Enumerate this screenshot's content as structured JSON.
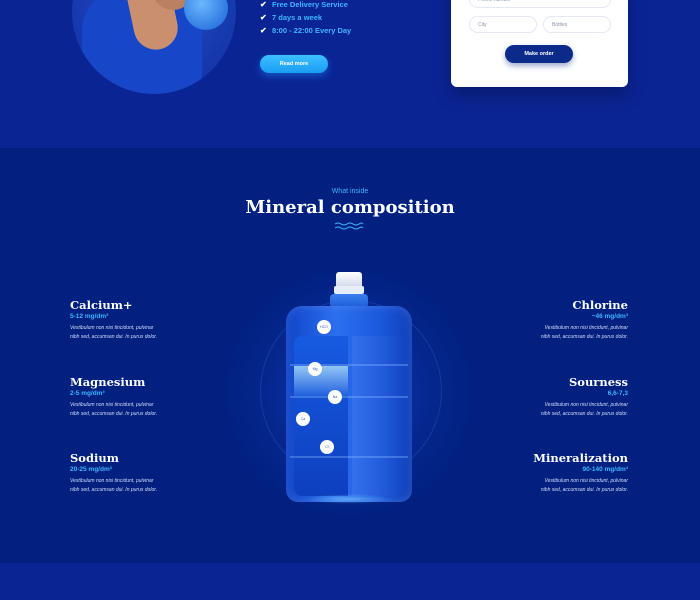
{
  "hero": {
    "features": [
      "Free Delivery Service",
      "7 days a week",
      "8:00 - 22:00 Every Day"
    ],
    "read_more_label": "Read more"
  },
  "order_form": {
    "phone_placeholder": "Phone number",
    "city_placeholder": "City",
    "bottles_placeholder": "Bottles",
    "submit_label": "Make order"
  },
  "composition": {
    "eyebrow": "What inside",
    "title": "Mineral composition",
    "bubbles": [
      "HCO",
      "Mg",
      "Na",
      "Ca",
      "Cl"
    ],
    "left": [
      {
        "name": "Calcium+",
        "range": "5-12 mg/dm³",
        "desc_1": "Vestibulum non nisi tincidunt, pulvinar",
        "desc_2": "nibh sed, accumsan dui. In purus dolor."
      },
      {
        "name": "Magnesium",
        "range": "2-5 mg/dm³",
        "desc_1": "Vestibulum non nisi tincidunt, pulvinar",
        "desc_2": "nibh sed, accumsan dui. In purus dolor."
      },
      {
        "name": "Sodium",
        "range": "20-25 mg/dm³",
        "desc_1": "Vestibulum non nisi tincidunt, pulvinar",
        "desc_2": "nibh sed, accumsan dui. In purus dolor."
      }
    ],
    "right": [
      {
        "name": "Chlorine",
        "range": "~46 mg/dm³",
        "desc_1": "Vestibulum non nisi tincidunt, pulvinar",
        "desc_2": "nibh sed, accumsan dui. In purus dolor."
      },
      {
        "name": "Sourness",
        "range": "6,6-7,3",
        "desc_1": "Vestibulum non nisi tincidunt, pulvinar",
        "desc_2": "nibh sed, accumsan dui. In purus dolor."
      },
      {
        "name": "Mineralization",
        "range": "90-140 mg/dm³",
        "desc_1": "Vestibulum non nisi tincidunt, pulvinar",
        "desc_2": "nibh sed, accumsan dui. In purus dolor."
      }
    ]
  },
  "colors": {
    "background": "#012080",
    "accent": "#3fb6ff",
    "card": "#ffffff"
  },
  "icons": [
    "check-icon",
    "wave-divider-icon",
    "water-bottle-image",
    "delivery-man-photo"
  ]
}
